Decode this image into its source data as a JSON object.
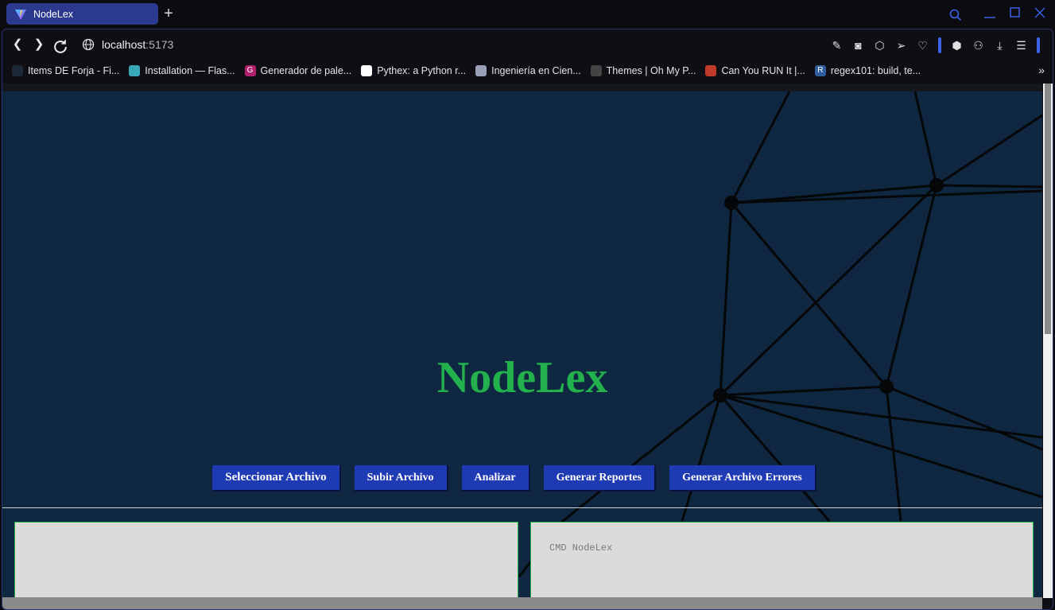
{
  "tab": {
    "title": "NodeLex"
  },
  "address_bar": {
    "host": "localhost",
    "port": ":5173"
  },
  "bookmarks": [
    {
      "label": "Items DE Forja - Fi...",
      "icon": "steam-icon",
      "color": "#1b2838"
    },
    {
      "label": "Installation — Flas...",
      "icon": "flask-icon",
      "color": "#3aa6b9"
    },
    {
      "label": "Generador de pale...",
      "icon": "g-icon",
      "color": "#b0206a",
      "glyph": "G"
    },
    {
      "label": "Pythex: a Python r...",
      "icon": "pythex-icon",
      "color": "#ffffff"
    },
    {
      "label": "Ingeniería en Cien...",
      "icon": "globe-icon",
      "color": "#9aa0b8"
    },
    {
      "label": "Themes | Oh My P...",
      "icon": "terminal-icon",
      "color": "#444444"
    },
    {
      "label": "Can You RUN It |...",
      "icon": "canyourunit-icon",
      "color": "#c0392b"
    },
    {
      "label": "regex101: build, te...",
      "icon": "regex101-icon",
      "color": "#2e5d9b",
      "glyph": "R"
    }
  ],
  "app": {
    "title": "NodeLex",
    "buttons": [
      {
        "label": "Seleccionar Archivo"
      },
      {
        "label": "Subir Archivo"
      },
      {
        "label": "Analizar"
      },
      {
        "label": "Generar Reportes"
      },
      {
        "label": "Generar Archivo Errores"
      }
    ],
    "editor_text": "",
    "console_label": "CMD NodeLex"
  },
  "colors": {
    "accent": "#3b63e6",
    "button": "#1f3bb3",
    "title_green": "#22b14c",
    "page_bg": "#0f2740"
  }
}
